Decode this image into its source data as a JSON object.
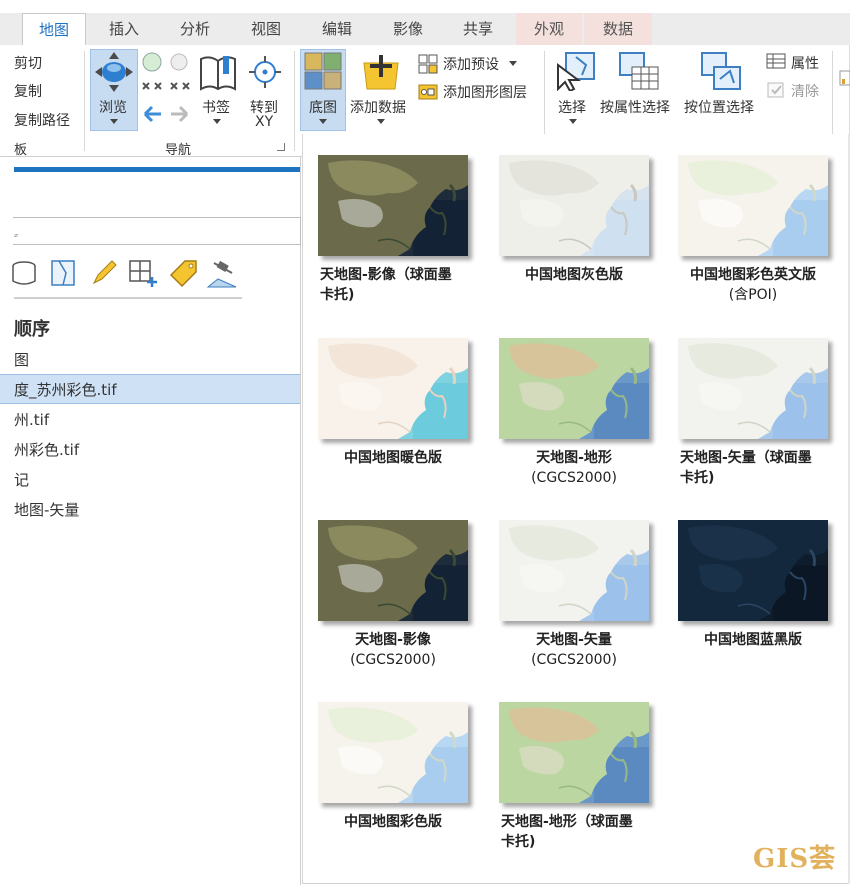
{
  "tabs": [
    "地图",
    "插入",
    "分析",
    "视图",
    "编辑",
    "影像",
    "共享",
    "外观",
    "数据"
  ],
  "ribbon": {
    "clipboard": {
      "cut": "剪切",
      "copy": "复制",
      "copy_path": "复制路径",
      "group": "板"
    },
    "navigate": {
      "explore": "浏览",
      "bookmarks": "书签",
      "goto_line1": "转到",
      "goto_line2": "XY",
      "group": "导航"
    },
    "layer": {
      "basemap": "底图",
      "add_data": "添加数据",
      "add_preset": "添加预设",
      "add_graphics_layer": "添加图形图层"
    },
    "selection": {
      "select": "选择",
      "select_by_attributes": "按属性选择",
      "select_by_location": "按位置选择",
      "attributes": "属性",
      "clear": "清除"
    }
  },
  "toc": {
    "search_glyph": "ٍ",
    "heading": "顺序",
    "items": [
      "图",
      "度_苏州彩色.tif",
      "州.tif",
      "州彩色.tif",
      "记",
      "地图-矢量"
    ],
    "selected_index": 1
  },
  "basemaps": [
    {
      "line1": "天地图-影像（球面墨",
      "line2": "卡托)",
      "style": "imagery"
    },
    {
      "line1": "中国地图灰色版",
      "line2": "",
      "style": "gray"
    },
    {
      "line1": "中国地图彩色英文版",
      "line2": "(含POI)",
      "style": "color"
    },
    {
      "line1": "中国地图暖色版",
      "line2": "",
      "style": "warm"
    },
    {
      "line1": "天地图-地形",
      "line2": "(CGCS2000)",
      "style": "terrain"
    },
    {
      "line1": "天地图-矢量（球面墨",
      "line2": "卡托)",
      "style": "vector"
    },
    {
      "line1": "天地图-影像",
      "line2": "(CGCS2000)",
      "style": "imagery"
    },
    {
      "line1": "天地图-矢量",
      "line2": "(CGCS2000)",
      "style": "vector"
    },
    {
      "line1": "中国地图蓝黑版",
      "line2": "",
      "style": "dark"
    },
    {
      "line1": "中国地图彩色版",
      "line2": "",
      "style": "color"
    },
    {
      "line1": "天地图-地形（球面墨",
      "line2": "卡托)",
      "style": "terrain"
    }
  ],
  "watermark": "GIS荟",
  "colors": {
    "accent": "#1c72c4",
    "tab_context_bg": "#f4e0dc",
    "selected_row": "#cfe1f4"
  }
}
